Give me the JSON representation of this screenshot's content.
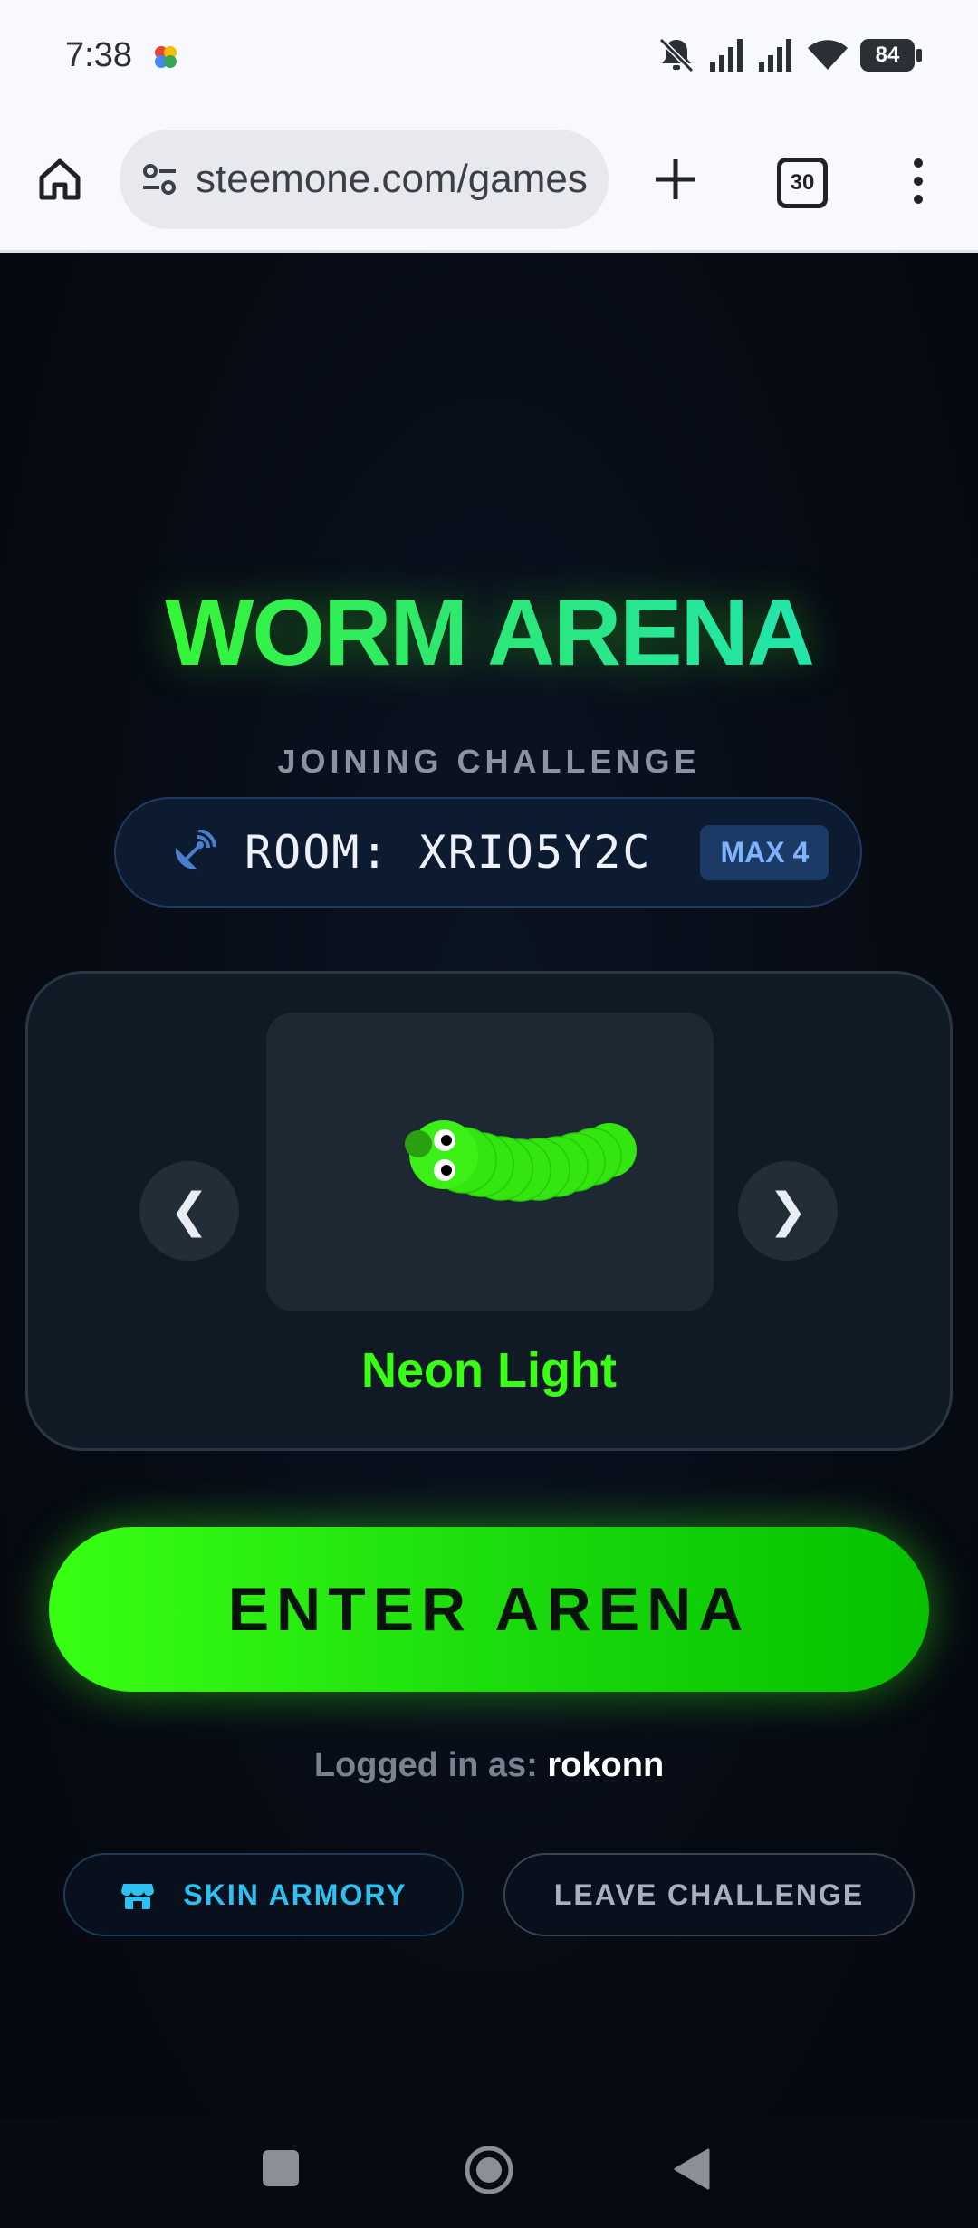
{
  "status_bar": {
    "time": "7:38",
    "battery": "84",
    "icons": [
      "photos-pinwheel-icon",
      "mute-icon",
      "signal-icon",
      "signal-icon",
      "wifi-icon",
      "battery-icon"
    ]
  },
  "browser": {
    "url": "steemone.com/games",
    "tab_count": "30"
  },
  "game": {
    "title": "WORM ARENA",
    "subtitle": "JOINING CHALLENGE",
    "room_label": "ROOM: XRIO5Y2C",
    "max_badge": "MAX 4",
    "skin": {
      "name": "Neon Light",
      "prev_label": "❮",
      "next_label": "❯",
      "color": "#39ff14"
    },
    "enter_button": "ENTER ARENA",
    "logged_in_prefix": "Logged in as:",
    "username": "rokonn",
    "skin_armory_button": "SKIN ARMORY",
    "leave_button": "LEAVE CHALLENGE"
  },
  "colors": {
    "accent_green": "#39ff14",
    "accent_cyan": "#2cc1f1",
    "background": "#060a12"
  }
}
